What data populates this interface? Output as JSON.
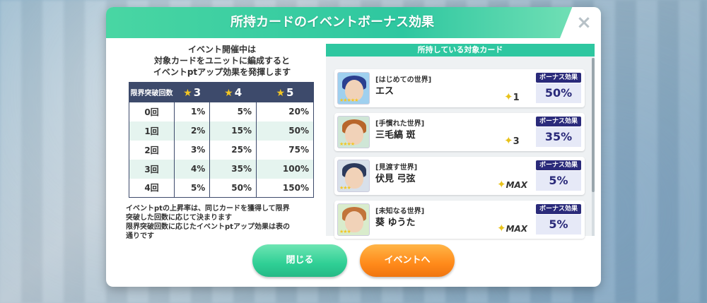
{
  "dialog": {
    "title": "所持カードのイベントボーナス効果",
    "close_icon": "×"
  },
  "intro": {
    "line1": "イベント開催中は",
    "line2": "対象カードをユニットに編成すると",
    "line3": "イベントptアップ効果を発揮します"
  },
  "table": {
    "header_label": "限界突破回数",
    "header_cols": [
      "3",
      "4",
      "5"
    ],
    "rows": [
      {
        "label": "0回",
        "v3": "1%",
        "v4": "5%",
        "v5": "20%"
      },
      {
        "label": "1回",
        "v3": "2%",
        "v4": "15%",
        "v5": "50%"
      },
      {
        "label": "2回",
        "v3": "3%",
        "v4": "25%",
        "v5": "75%"
      },
      {
        "label": "3回",
        "v3": "4%",
        "v4": "35%",
        "v5": "100%"
      },
      {
        "label": "4回",
        "v3": "5%",
        "v4": "50%",
        "v5": "150%"
      }
    ]
  },
  "note": {
    "line1": "イベントptの上昇率は、同じカードを獲得して限界",
    "line2": "突破した回数に応じて決まります",
    "line3": "限界突破回数に応じたイベントptアップ効果は表の",
    "line4": "通りです"
  },
  "owned": {
    "header": "所持している対象カード",
    "bonus_label": "ボーナス効果",
    "cards": [
      {
        "series": "[はじめての世界]",
        "name": "エス",
        "limit": "1",
        "bonus": "50%",
        "hair": "#2b3f8f",
        "rarity": "★★★★★"
      },
      {
        "series": "[手慣れた世界]",
        "name": "三毛縞 斑",
        "limit": "3",
        "bonus": "35%",
        "hair": "#b8662b",
        "rarity": "★★★★"
      },
      {
        "series": "[見渡す世界]",
        "name": "伏見 弓弦",
        "limit": "MAX",
        "bonus": "5%",
        "hair": "#2c3a5c",
        "rarity": "★★★"
      },
      {
        "series": "[未知なる世界]",
        "name": "葵 ゆうた",
        "limit": "MAX",
        "bonus": "5%",
        "hair": "#c2743a",
        "rarity": "★★★"
      }
    ]
  },
  "buttons": {
    "close": "閉じる",
    "event": "イベントへ"
  }
}
